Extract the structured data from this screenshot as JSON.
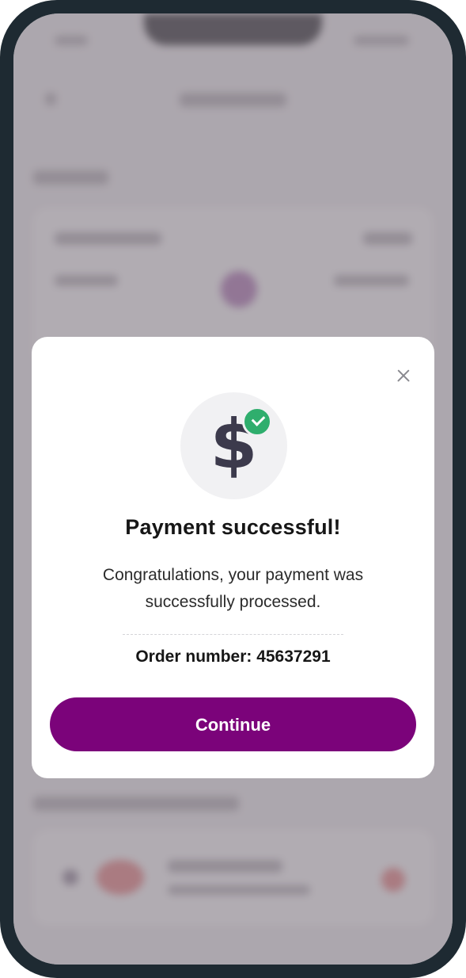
{
  "modal": {
    "title": "Payment successful!",
    "message": "Congratulations, your payment was successfully processed.",
    "order_line": "Order number: 45637291",
    "continue_label": "Continue",
    "close_icon": "close-icon",
    "success_icon": "dollar-check-icon"
  },
  "colors": {
    "primary": "#7b037a",
    "success": "#2fae6d",
    "icon_dark": "#3c3a4c",
    "frame": "#1e2a32",
    "overlay": "#78707a"
  }
}
